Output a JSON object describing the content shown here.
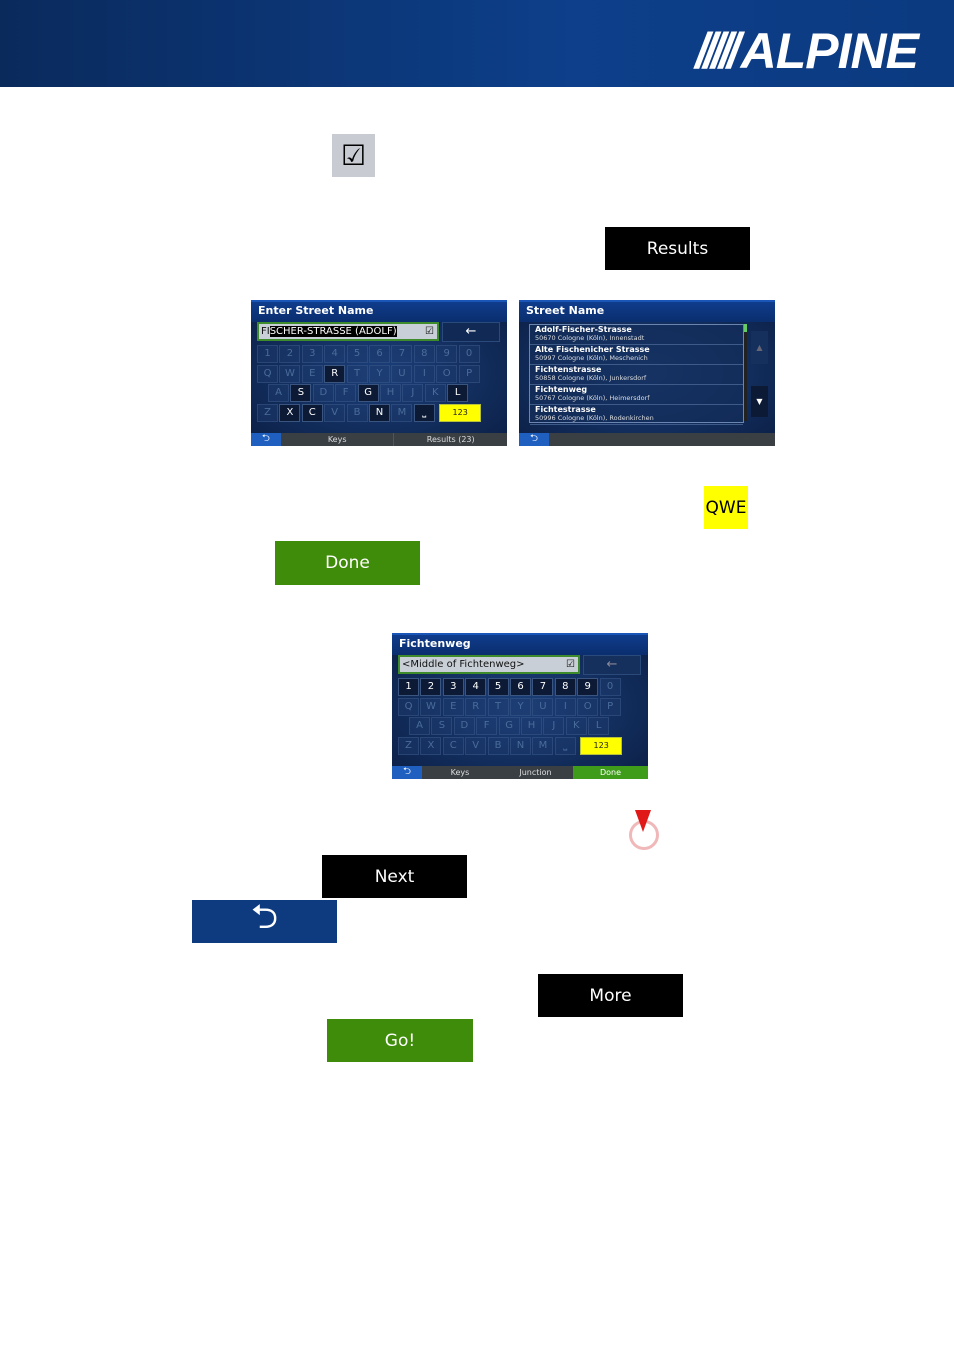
{
  "header": {
    "brand": "ALPINE",
    "brand_color": "#0d3f8a"
  },
  "icons": {
    "checkbox": "checkbox-icon",
    "pin": "map-pin-icon",
    "back": "back-arrow-icon"
  },
  "buttons": {
    "results": "Results",
    "qwe": "QWE",
    "done": "Done",
    "next": "Next",
    "more": "More",
    "go": "Go!"
  },
  "screen1": {
    "title": "Enter Street Name",
    "input_prefix": "FI",
    "input_selected": "SCHER-STRASSE (ADOLF)",
    "backspace": "←",
    "rows": [
      [
        "1",
        "2",
        "3",
        "4",
        "5",
        "6",
        "7",
        "8",
        "9",
        "0"
      ],
      [
        "Q",
        "W",
        "E",
        "R",
        "T",
        "Y",
        "U",
        "I",
        "O",
        "P"
      ],
      [
        "A",
        "S",
        "D",
        "F",
        "G",
        "H",
        "J",
        "K",
        "L"
      ],
      [
        "Z",
        "X",
        "C",
        "V",
        "B",
        "N",
        "M",
        "␣"
      ]
    ],
    "active": [
      "R",
      "S",
      "G",
      "L",
      "X",
      "C",
      "N",
      "␣"
    ],
    "mode_key": "123",
    "keys_label": "Keys",
    "results_label": "Results (23)"
  },
  "screen2": {
    "title": "Street Name",
    "items": [
      {
        "name": "Adolf-Fischer-Strasse",
        "addr": "50670 Cologne (Köln), Innenstadt"
      },
      {
        "name": "Alte Fischenicher Strasse",
        "addr": "50997 Cologne (Köln), Meschenich"
      },
      {
        "name": "Fichtenstrasse",
        "addr": "50858 Cologne (Köln), Junkersdorf"
      },
      {
        "name": "Fichtenweg",
        "addr": "50767 Cologne (Köln), Heimersdorf"
      },
      {
        "name": "Fichtestrasse",
        "addr": "50996 Cologne (Köln), Rodenkirchen"
      }
    ],
    "up": "▲",
    "down": "▼"
  },
  "screen3": {
    "title": "Fichtenweg",
    "input": "<Middle of Fichtenweg>",
    "backspace": "←",
    "rows": [
      [
        "1",
        "2",
        "3",
        "4",
        "5",
        "6",
        "7",
        "8",
        "9",
        "0"
      ],
      [
        "Q",
        "W",
        "E",
        "R",
        "T",
        "Y",
        "U",
        "I",
        "O",
        "P"
      ],
      [
        "A",
        "S",
        "D",
        "F",
        "G",
        "H",
        "J",
        "K",
        "L"
      ],
      [
        "Z",
        "X",
        "C",
        "V",
        "B",
        "N",
        "M",
        "␣"
      ]
    ],
    "active": [
      "1",
      "2",
      "3",
      "4",
      "5",
      "6",
      "7",
      "8",
      "9"
    ],
    "mode_key": "123",
    "keys_label": "Keys",
    "junction_label": "Junction",
    "done_label": "Done"
  }
}
